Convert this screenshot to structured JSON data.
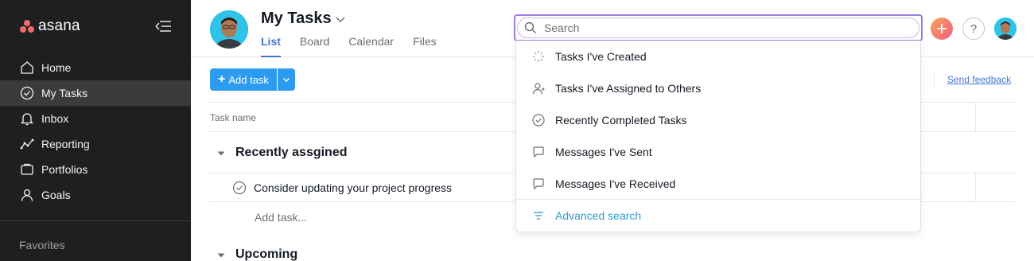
{
  "sidebar": {
    "logo_text": "asana",
    "items": [
      {
        "label": "Home",
        "icon": "home-icon"
      },
      {
        "label": "My Tasks",
        "icon": "check-circle-icon",
        "active": true
      },
      {
        "label": "Inbox",
        "icon": "bell-icon"
      },
      {
        "label": "Reporting",
        "icon": "chart-line-icon"
      },
      {
        "label": "Portfolios",
        "icon": "folder-icon"
      },
      {
        "label": "Goals",
        "icon": "person-icon"
      }
    ],
    "favorites_label": "Favorites"
  },
  "header": {
    "title": "My Tasks",
    "tabs": [
      {
        "label": "List",
        "active": true
      },
      {
        "label": "Board"
      },
      {
        "label": "Calendar"
      },
      {
        "label": "Files"
      }
    ],
    "help_label": "?"
  },
  "toolbar": {
    "add_task_label": "Add task",
    "send_feedback_label": "Send feedback"
  },
  "table": {
    "column_task_name": "Task name",
    "sections": [
      {
        "title": "Recently assgined",
        "tasks": [
          "Consider updating your project progress"
        ],
        "add_task_label": "Add task..."
      },
      {
        "title": "Upcoming"
      }
    ]
  },
  "search": {
    "placeholder": "Search",
    "value": "",
    "options": [
      {
        "label": "Tasks I've Created",
        "icon": "spinner-icon"
      },
      {
        "label": "Tasks I've Assigned to Others",
        "icon": "person-assign-icon"
      },
      {
        "label": "Recently Completed Tasks",
        "icon": "check-circle-icon"
      },
      {
        "label": "Messages I've Sent",
        "icon": "speech-bubble-icon"
      },
      {
        "label": "Messages I've Received",
        "icon": "speech-bubble-icon"
      }
    ],
    "advanced_label": "Advanced search"
  },
  "colors": {
    "sidebar_bg": "#1e1f21",
    "accent": "#4573d2",
    "button_blue": "#2d9bf0",
    "search_focus": "#9d7ddb",
    "advanced_link": "#2d9bd3"
  }
}
